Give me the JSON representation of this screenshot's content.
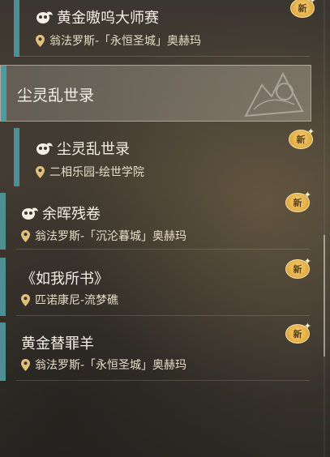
{
  "section": {
    "label": "尘灵乱世录"
  },
  "badge_text": "新",
  "items": [
    {
      "title": "黄金嗷呜大师赛",
      "location": "翁法罗斯-「永恒圣城」奥赫玛",
      "has_mask_icon": true
    },
    {
      "title": "尘灵乱世录",
      "location": "二相乐园-绘世学院",
      "has_mask_icon": true
    },
    {
      "title": "余晖残卷",
      "location": "翁法罗斯-「沉沦暮城」奥赫玛",
      "has_mask_icon": true
    },
    {
      "title": "《如我所书》",
      "location": "匹诺康尼-流梦礁",
      "has_mask_icon": false
    },
    {
      "title": "黄金替罪羊",
      "location": "翁法罗斯-「永恒圣城」奥赫玛",
      "has_mask_icon": false
    }
  ],
  "colors": {
    "accent_bar": "#4d8f95",
    "badge": "#e0a93f",
    "text": "#f5efe4"
  },
  "icons": {
    "mask": "mask-icon",
    "pin": "pin-icon",
    "new": "new-badge"
  }
}
